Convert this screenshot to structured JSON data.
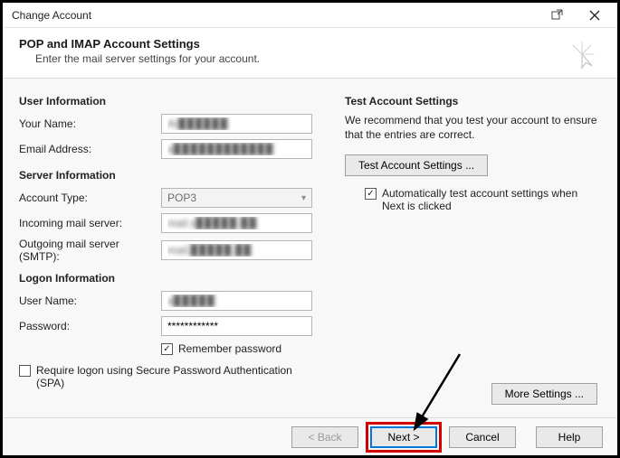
{
  "window": {
    "title": "Change Account"
  },
  "header": {
    "title": "POP and IMAP Account Settings",
    "subtitle": "Enter the mail server settings for your account."
  },
  "left": {
    "user_info_h": "User Information",
    "your_name_label": "Your Name:",
    "your_name_value": "Ar▉▉▉▉▉▉",
    "email_label": "Email Address:",
    "email_value": "a▉▉▉▉▉▉▉▉▉▉▉▉",
    "server_info_h": "Server Information",
    "account_type_label": "Account Type:",
    "account_type_value": "POP3",
    "incoming_label": "Incoming mail server:",
    "incoming_value": "mail.s▉▉▉▉▉.▉▉",
    "outgoing_label": "Outgoing mail server (SMTP):",
    "outgoing_value": "mail.▉▉▉▉▉.▉▉",
    "logon_h": "Logon Information",
    "username_label": "User Name:",
    "username_value": "a▉▉▉▉▉",
    "password_label": "Password:",
    "password_value": "************",
    "remember_label": "Remember password",
    "spa_label": "Require logon using Secure Password Authentication (SPA)"
  },
  "right": {
    "test_h": "Test Account Settings",
    "test_desc": "We recommend that you test your account to ensure that the entries are correct.",
    "test_btn": "Test Account Settings ...",
    "auto_test_label": "Automatically test account settings when Next is clicked",
    "more_settings": "More Settings ..."
  },
  "footer": {
    "back": "< Back",
    "next": "Next >",
    "cancel": "Cancel",
    "help": "Help"
  }
}
